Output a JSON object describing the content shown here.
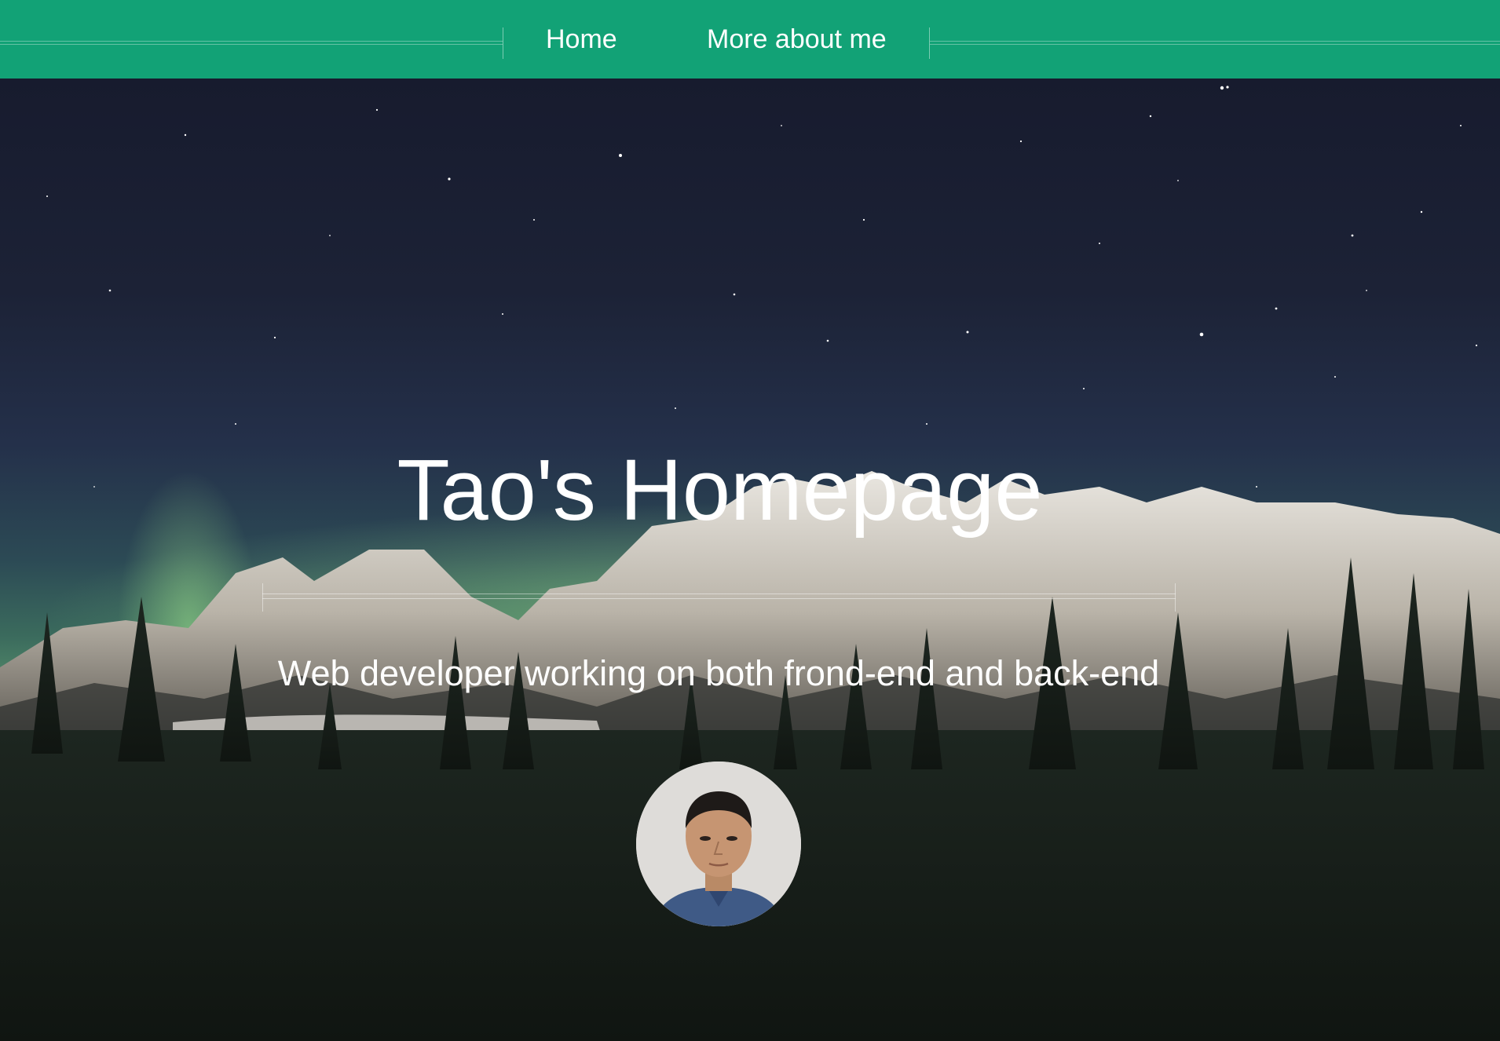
{
  "nav": {
    "home_label": "Home",
    "about_label": "More about me"
  },
  "hero": {
    "title": "Tao's Homepage",
    "subtitle": "Web developer working on both frond-end and back-end",
    "background": "night-sky-aurora-mountains"
  },
  "avatar": {
    "subject": "profile-photo"
  },
  "colors": {
    "navbar": "#12a276",
    "text": "#ffffff"
  }
}
